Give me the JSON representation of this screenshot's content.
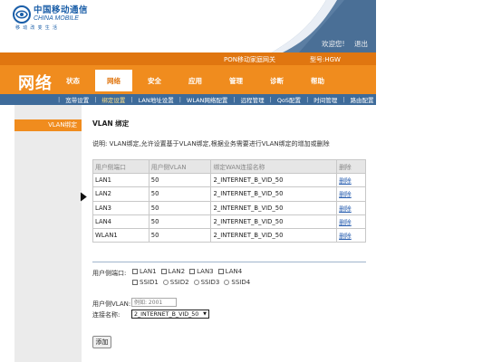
{
  "header": {
    "logo_cn": "中国移动通信",
    "logo_en": "CHINA MOBILE",
    "logo_slogan": "移动改变生活",
    "welcome": "欢迎您!",
    "logout": "退出",
    "colors": {
      "brand_blue": "#1a5ea8",
      "sweep_blue": "#4a6f96",
      "accent_orange": "#f08c1e"
    }
  },
  "nav": {
    "device_name": "PON移动家庭网关",
    "model_label": "型号:HGW",
    "section_title": "网络",
    "main_tabs": [
      {
        "label": "状态"
      },
      {
        "label": "网络"
      },
      {
        "label": "安全"
      },
      {
        "label": "应用"
      },
      {
        "label": "管理"
      },
      {
        "label": "诊断"
      },
      {
        "label": "帮助"
      }
    ],
    "sub_tabs": [
      {
        "label": "宽带设置"
      },
      {
        "label": "绑定设置"
      },
      {
        "label": "LAN地址设置"
      },
      {
        "label": "WLAN网络配置"
      },
      {
        "label": "远程管理"
      },
      {
        "label": "QoS配置"
      },
      {
        "label": "时间管理"
      },
      {
        "label": "路由配置"
      }
    ]
  },
  "sidebar": {
    "items": [
      {
        "label": "VLAN绑定"
      }
    ]
  },
  "content": {
    "title": "VLAN 绑定",
    "description": "说明: VLAN绑定,允许设置基于VLAN绑定,根据业务需要进行VLAN绑定的增加或删除",
    "table": {
      "headers": [
        "用户侧端口",
        "用户侧VLAN",
        "绑定WAN连接名称",
        "删除"
      ],
      "rows": [
        [
          "LAN1",
          "50",
          "2_INTERNET_B_VID_50",
          "删除"
        ],
        [
          "LAN2",
          "50",
          "2_INTERNET_B_VID_50",
          "删除"
        ],
        [
          "LAN3",
          "50",
          "2_INTERNET_B_VID_50",
          "删除"
        ],
        [
          "LAN4",
          "50",
          "2_INTERNET_B_VID_50",
          "删除"
        ],
        [
          "WLAN1",
          "50",
          "2_INTERNET_B_VID_50",
          "删除"
        ]
      ]
    },
    "form": {
      "port_label": "用户侧端口:",
      "lan_ports": [
        "LAN1",
        "LAN2",
        "LAN3",
        "LAN4"
      ],
      "ssid_ports": [
        "SSID1",
        "SSID2",
        "SSID3",
        "SSID4"
      ],
      "vlan_label": "用户侧VLAN:",
      "vlan_placeholder": "例如: 2001",
      "conn_label": "连接名称:",
      "conn_value": "2_INTERNET_B_VID_50",
      "add_button": "添加"
    }
  }
}
